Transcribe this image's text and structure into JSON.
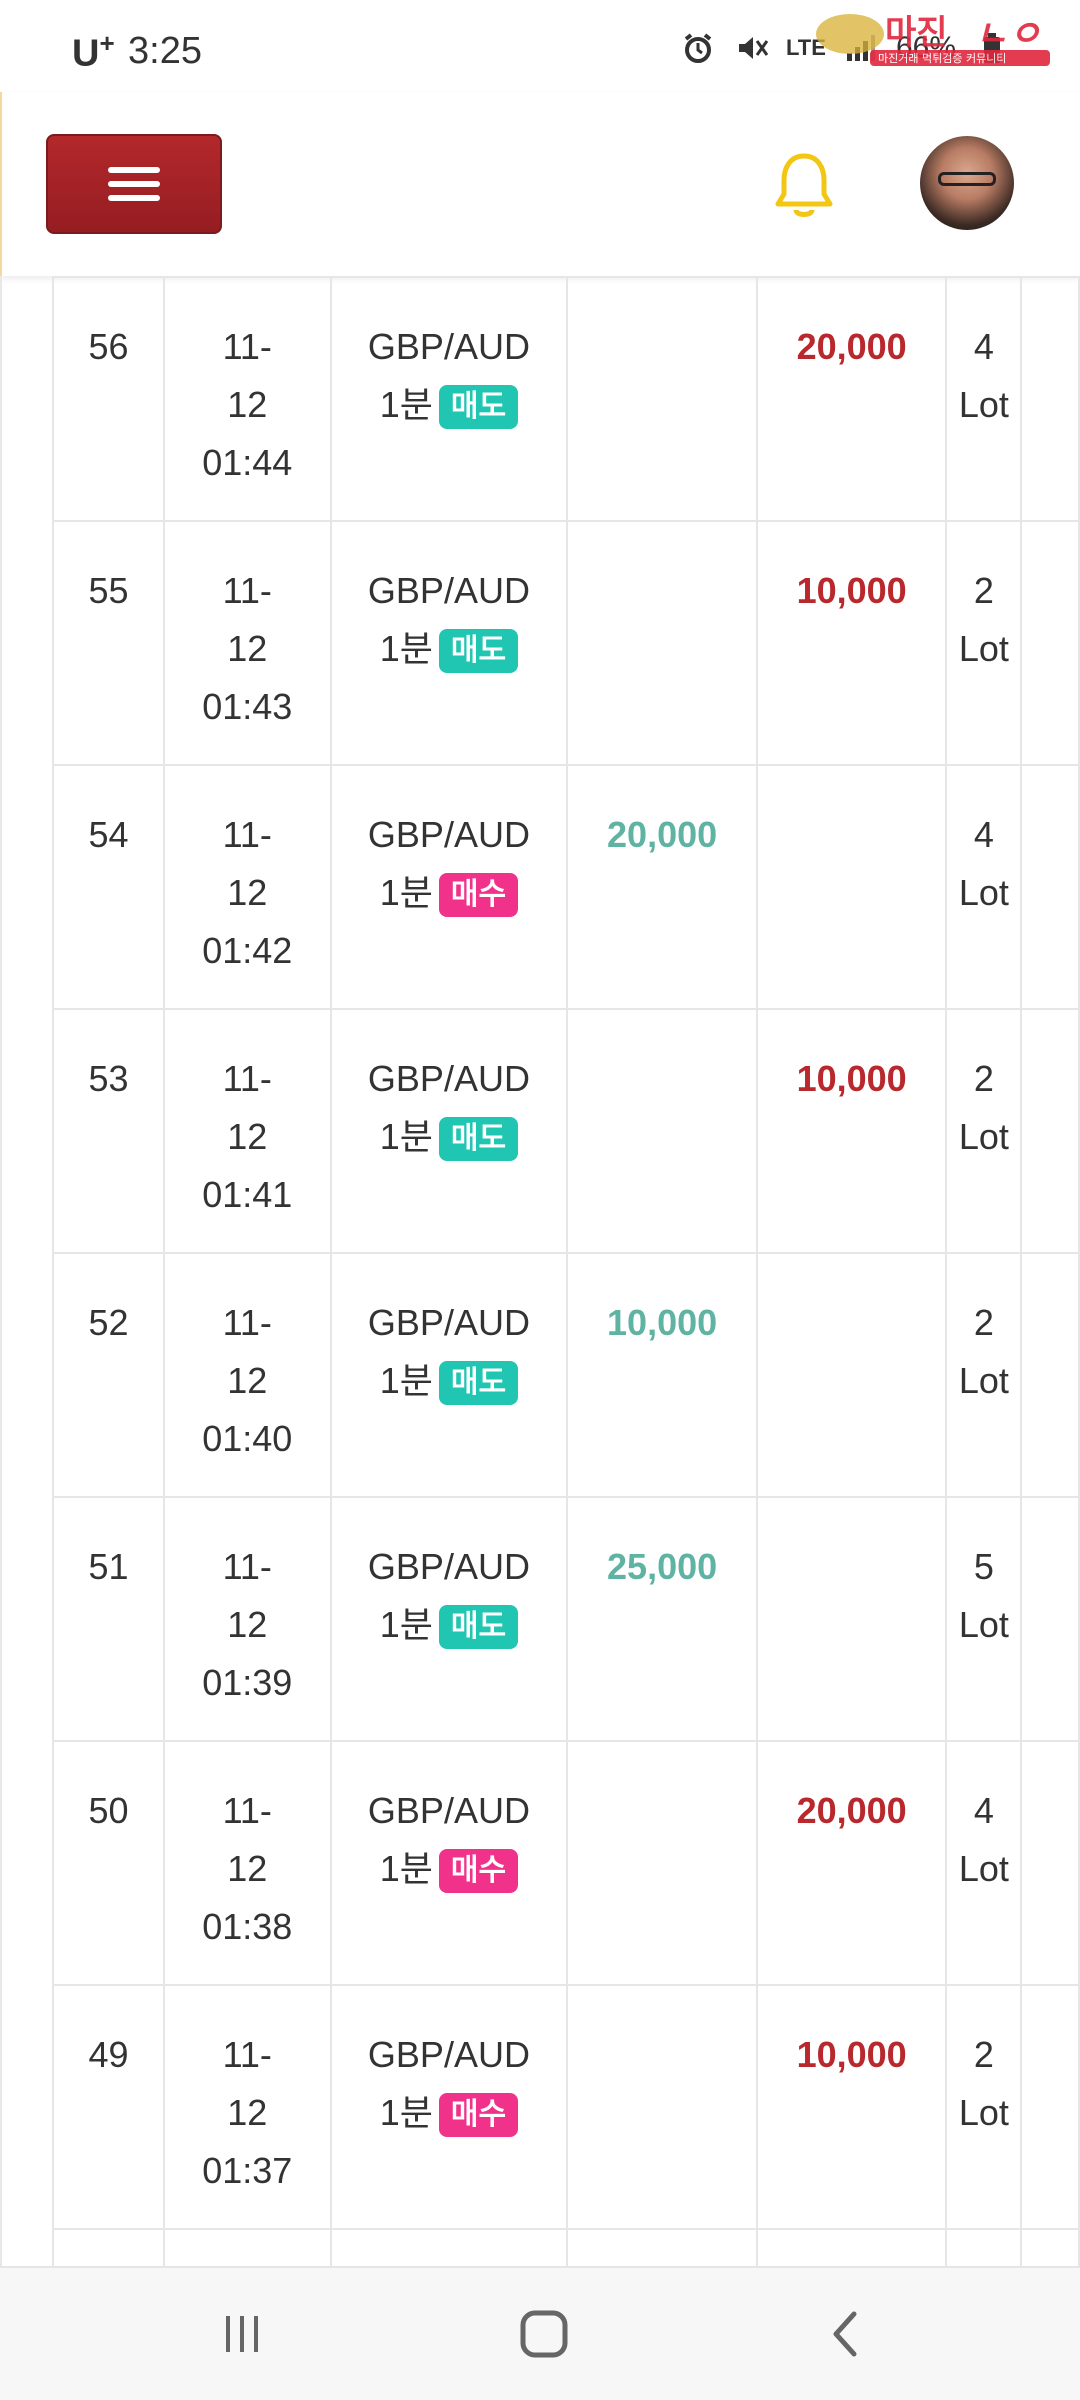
{
  "status_bar": {
    "carrier": "U",
    "carrier_plus": "+",
    "time": "3:25",
    "network": "LTE",
    "battery": "66%",
    "icons": [
      "alarm-icon",
      "mute-icon",
      "lte-icon",
      "signal-icon",
      "battery-icon"
    ]
  },
  "watermark": {
    "brand": "마진",
    "tagline": "마진거래 먹튀검증 커뮤니티"
  },
  "header": {
    "menu_icon": "hamburger-icon",
    "bell_icon": "bell-icon",
    "bell_color": "#f3c614",
    "avatar": "avatar"
  },
  "colors": {
    "menu_button": "#a52227",
    "profit": "#5fb3a3",
    "loss": "#b8282d",
    "sell_badge": "#20c6b1",
    "buy_badge": "#f0328a"
  },
  "rows": [
    {
      "no": "56",
      "date": "11-",
      "date2": "12",
      "time": "01:44",
      "pair": "GBP/AUD",
      "period": "1분",
      "side": "매도",
      "side_type": "sell",
      "win": "",
      "lose": "20,000",
      "lot": "4",
      "lot_unit": "Lot"
    },
    {
      "no": "55",
      "date": "11-",
      "date2": "12",
      "time": "01:43",
      "pair": "GBP/AUD",
      "period": "1분",
      "side": "매도",
      "side_type": "sell",
      "win": "",
      "lose": "10,000",
      "lot": "2",
      "lot_unit": "Lot"
    },
    {
      "no": "54",
      "date": "11-",
      "date2": "12",
      "time": "01:42",
      "pair": "GBP/AUD",
      "period": "1분",
      "side": "매수",
      "side_type": "buy",
      "win": "20,000",
      "lose": "",
      "lot": "4",
      "lot_unit": "Lot"
    },
    {
      "no": "53",
      "date": "11-",
      "date2": "12",
      "time": "01:41",
      "pair": "GBP/AUD",
      "period": "1분",
      "side": "매도",
      "side_type": "sell",
      "win": "",
      "lose": "10,000",
      "lot": "2",
      "lot_unit": "Lot"
    },
    {
      "no": "52",
      "date": "11-",
      "date2": "12",
      "time": "01:40",
      "pair": "GBP/AUD",
      "period": "1분",
      "side": "매도",
      "side_type": "sell",
      "win": "10,000",
      "lose": "",
      "lot": "2",
      "lot_unit": "Lot"
    },
    {
      "no": "51",
      "date": "11-",
      "date2": "12",
      "time": "01:39",
      "pair": "GBP/AUD",
      "period": "1분",
      "side": "매도",
      "side_type": "sell",
      "win": "25,000",
      "lose": "",
      "lot": "5",
      "lot_unit": "Lot"
    },
    {
      "no": "50",
      "date": "11-",
      "date2": "12",
      "time": "01:38",
      "pair": "GBP/AUD",
      "period": "1분",
      "side": "매수",
      "side_type": "buy",
      "win": "",
      "lose": "20,000",
      "lot": "4",
      "lot_unit": "Lot"
    },
    {
      "no": "49",
      "date": "11-",
      "date2": "12",
      "time": "01:37",
      "pair": "GBP/AUD",
      "period": "1분",
      "side": "매수",
      "side_type": "buy",
      "win": "",
      "lose": "10,000",
      "lot": "2",
      "lot_unit": "Lot"
    }
  ],
  "nav": {
    "recents_icon": "recents-icon",
    "home_icon": "home-icon",
    "back_icon": "back-icon"
  }
}
